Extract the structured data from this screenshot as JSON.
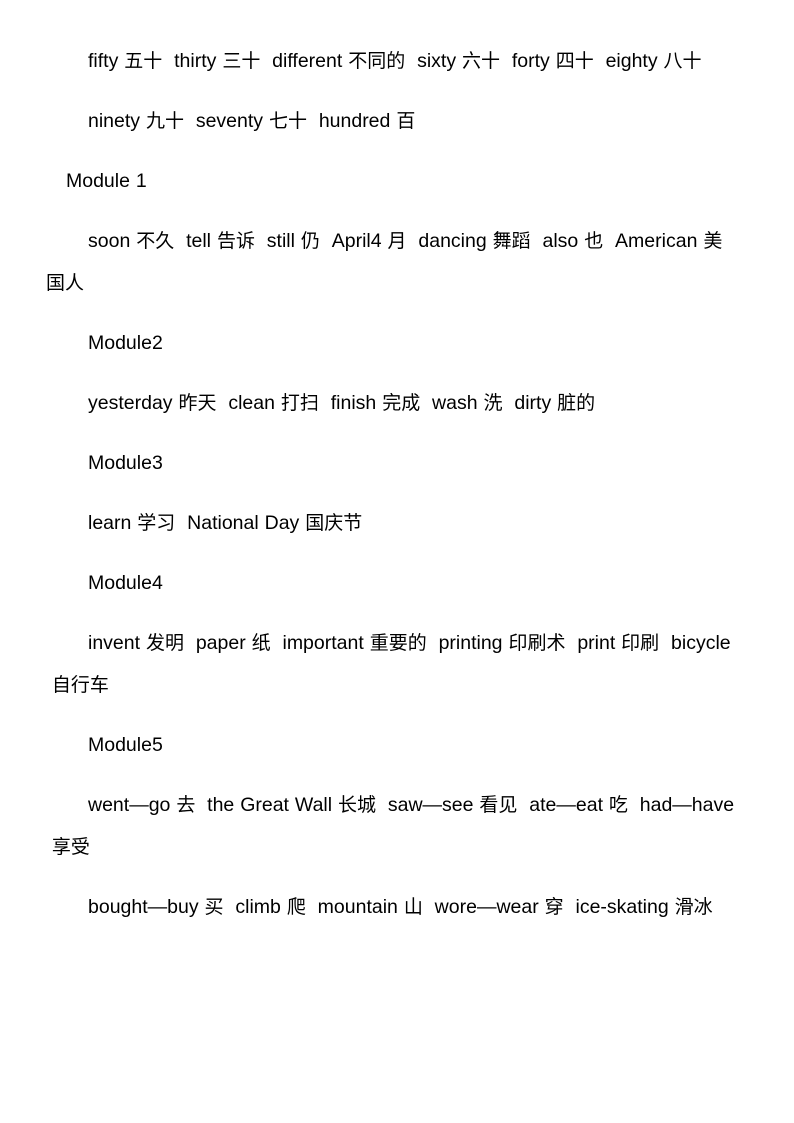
{
  "document": {
    "page_background": "#ffffff",
    "text_color": "#000000",
    "blocks": [
      {
        "kind": "vocab",
        "name": "vocab-line-numbers",
        "entries": [
          {
            "en": "fifty",
            "zh": "五十"
          },
          {
            "en": "thirty",
            "zh": "三十"
          },
          {
            "en": "different",
            "zh": "不同的"
          },
          {
            "en": "sixty",
            "zh": "六十"
          },
          {
            "en": "forty",
            "zh": "四十"
          },
          {
            "en": "eighty",
            "zh": "八十"
          }
        ]
      },
      {
        "kind": "vocab",
        "name": "vocab-line-numbers-2",
        "entries": [
          {
            "en": "ninety",
            "zh": "九十"
          },
          {
            "en": "seventy",
            "zh": "七十"
          },
          {
            "en": "hundred",
            "zh": "百"
          }
        ]
      },
      {
        "kind": "module-head-first",
        "name": "module-heading-1",
        "label": "Module 1"
      },
      {
        "kind": "vocab",
        "name": "vocab-module-1",
        "entries": [
          {
            "en": "soon",
            "zh": "不久"
          },
          {
            "en": "tell",
            "zh": "告诉"
          },
          {
            "en": "still",
            "zh": "仍"
          },
          {
            "en": "April4",
            "zh": "月"
          },
          {
            "en": "dancing",
            "zh": "舞蹈"
          },
          {
            "en": "also",
            "zh": "也"
          },
          {
            "en": "American",
            "zh": "美国人"
          }
        ]
      },
      {
        "kind": "module-head",
        "name": "module-heading-2",
        "label": "Module2"
      },
      {
        "kind": "vocab",
        "name": "vocab-module-2",
        "entries": [
          {
            "en": "yesterday",
            "zh": "昨天"
          },
          {
            "en": "clean",
            "zh": "打扫"
          },
          {
            "en": "finish",
            "zh": "完成"
          },
          {
            "en": "wash",
            "zh": "洗"
          },
          {
            "en": "dirty",
            "zh": "脏的"
          }
        ]
      },
      {
        "kind": "module-head",
        "name": "module-heading-3",
        "label": "Module3"
      },
      {
        "kind": "vocab",
        "name": "vocab-module-3",
        "entries": [
          {
            "en": "learn",
            "zh": "学习"
          },
          {
            "en": "National Day",
            "zh": "国庆节"
          }
        ]
      },
      {
        "kind": "module-head",
        "name": "module-heading-4",
        "label": "Module4"
      },
      {
        "kind": "vocab",
        "name": "vocab-module-4",
        "entries": [
          {
            "en": "invent",
            "zh": "发明"
          },
          {
            "en": "paper",
            "zh": "纸"
          },
          {
            "en": "important",
            "zh": "重要的"
          },
          {
            "en": "printing",
            "zh": "印刷术"
          },
          {
            "en": "print",
            "zh": "印刷"
          },
          {
            "en": "bicycle",
            "zh": "自行车"
          }
        ]
      },
      {
        "kind": "module-head",
        "name": "module-heading-5",
        "label": "Module5"
      },
      {
        "kind": "vocab",
        "name": "vocab-module-5-a",
        "entries": [
          {
            "en": "went—go",
            "zh": "去"
          },
          {
            "en": "the Great Wall",
            "zh": "长城"
          },
          {
            "en": "saw—see",
            "zh": "看见"
          },
          {
            "en": "ate—eat",
            "zh": "吃"
          },
          {
            "en": "had—have",
            "zh": "享受"
          }
        ]
      },
      {
        "kind": "vocab",
        "name": "vocab-module-5-b",
        "entries": [
          {
            "en": "bought—buy",
            "zh": "买"
          },
          {
            "en": "climb",
            "zh": "爬"
          },
          {
            "en": "mountain",
            "zh": "山"
          },
          {
            "en": "wore—wear",
            "zh": "穿"
          },
          {
            "en": "ice-skating",
            "zh": "滑冰"
          }
        ]
      }
    ]
  }
}
